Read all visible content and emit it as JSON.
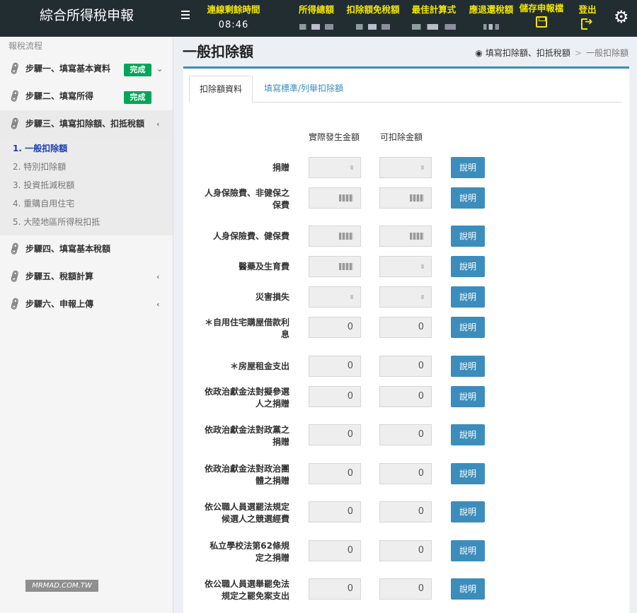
{
  "app": {
    "title": "綜合所得稅申報"
  },
  "header": {
    "countdown_label": "連線剩餘時間",
    "countdown_value": "08:46",
    "income_label": "所得總額",
    "deduction_label": "扣除額免稅額",
    "best_calc_label": "最佳計算式",
    "refund_label": "應退還稅額",
    "save_label": "儲存申報檔",
    "logout_label": "登出"
  },
  "sidebar": {
    "header": "報稅流程",
    "steps": [
      {
        "label": "步驟一、填寫基本資料",
        "badge": "完成"
      },
      {
        "label": "步驟二、填寫所得",
        "badge": "完成"
      },
      {
        "label": "步驟三、填寫扣除額、扣抵稅額"
      },
      {
        "label": "步驟四、填寫基本稅額"
      },
      {
        "label": "步驟五、稅額計算"
      },
      {
        "label": "步驟六、申報上傳"
      }
    ],
    "subitems": [
      "1. 一般扣除額",
      "2. 特別扣除額",
      "3. 投資抵減稅額",
      "4. 重購自用住宅",
      "5. 大陸地區所得稅扣抵"
    ]
  },
  "page": {
    "title": "一般扣除額",
    "breadcrumb_1": "填寫扣除額、扣抵稅額",
    "breadcrumb_sep": ">",
    "breadcrumb_2": "一般扣除額"
  },
  "tabs": {
    "tab1": "扣除額資料",
    "tab2": "填寫標準/列舉扣除額"
  },
  "columns": {
    "actual": "實際發生金額",
    "deductible": "可扣除金額"
  },
  "rows": [
    {
      "label1": "捐贈",
      "label2": "",
      "v1": "",
      "v2": "",
      "button": "說明"
    },
    {
      "label1": "人身保險費、非健保之",
      "label2": "保費",
      "v1": "",
      "v2": "",
      "button": "說明"
    },
    {
      "label1": "人身保險費、健保費",
      "label2": "",
      "v1": "",
      "v2": "",
      "button": "說明"
    },
    {
      "label1": "醫藥及生育費",
      "label2": "",
      "v1": "",
      "v2": "",
      "button": "說明"
    },
    {
      "label1": "災害損失",
      "label2": "",
      "v1": "",
      "v2": "",
      "button": "說明"
    },
    {
      "label1": "＊自用住宅購屋借款利",
      "label2": "息",
      "v1": "0",
      "v2": "0",
      "button": "說明"
    },
    {
      "label1": "＊房屋租金支出",
      "label2": "",
      "v1": "0",
      "v2": "0",
      "button": "說明"
    },
    {
      "label1": "依政治獻金法對擬參選",
      "label2": "人之捐贈",
      "v1": "0",
      "v2": "0",
      "button": "說明"
    },
    {
      "label1": "依政治獻金法對政黨之",
      "label2": "捐贈",
      "v1": "0",
      "v2": "0",
      "button": "說明"
    },
    {
      "label1": "依政治獻金法對政治團",
      "label2": "體之捐贈",
      "v1": "0",
      "v2": "0",
      "button": "說明"
    },
    {
      "label1": "依公職人員選罷法規定",
      "label2": "候選人之競選經費",
      "v1": "0",
      "v2": "0",
      "button": "說明"
    },
    {
      "label1": "私立學校法第62條規",
      "label2": "定之捐贈",
      "v1": "0",
      "v2": "0",
      "button": "說明"
    },
    {
      "label1": "依公職人員選舉罷免法",
      "label2": "規定之罷免案支出",
      "v1": "0",
      "v2": "0",
      "button": "說明"
    }
  ],
  "watermark": "MRMAD.COM.TW"
}
